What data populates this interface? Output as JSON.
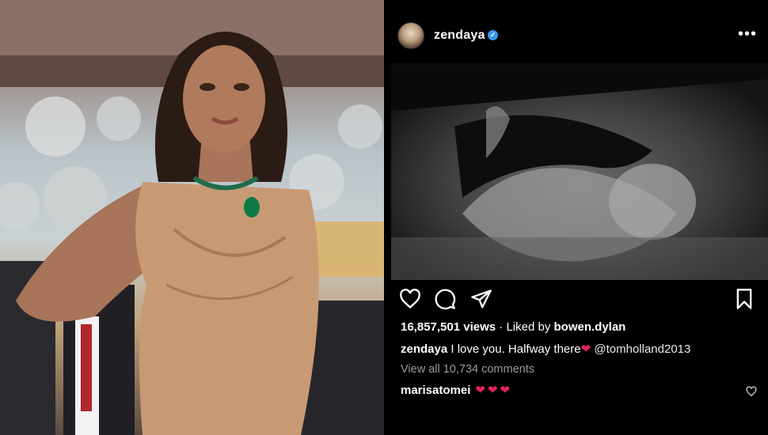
{
  "post": {
    "username": "zendaya",
    "verified_mark": "✓",
    "more_label": "•••",
    "views": "16,857,501 views",
    "separator": " · ",
    "liked_prefix": "Liked by ",
    "liked_by": "bowen.dylan",
    "caption_user": "zendaya",
    "caption_text": " I love you. Halfway there",
    "caption_heart": "❤",
    "caption_mention": " @tomholland2013",
    "view_all_comments": "View all 10,734 comments",
    "comment_user": "marisatomei",
    "comment_text": "❤❤❤"
  },
  "icons": {
    "like": "heart-outline-icon",
    "comment": "comment-bubble-icon",
    "share": "paper-plane-icon",
    "save": "bookmark-icon",
    "comment_like": "small-heart-icon",
    "verified": "verified-badge-icon",
    "more": "more-options-icon"
  },
  "colors": {
    "background": "#000000",
    "verified": "#3897f0",
    "heart": "#e0245e",
    "muted_text": "#9a9a9a"
  }
}
